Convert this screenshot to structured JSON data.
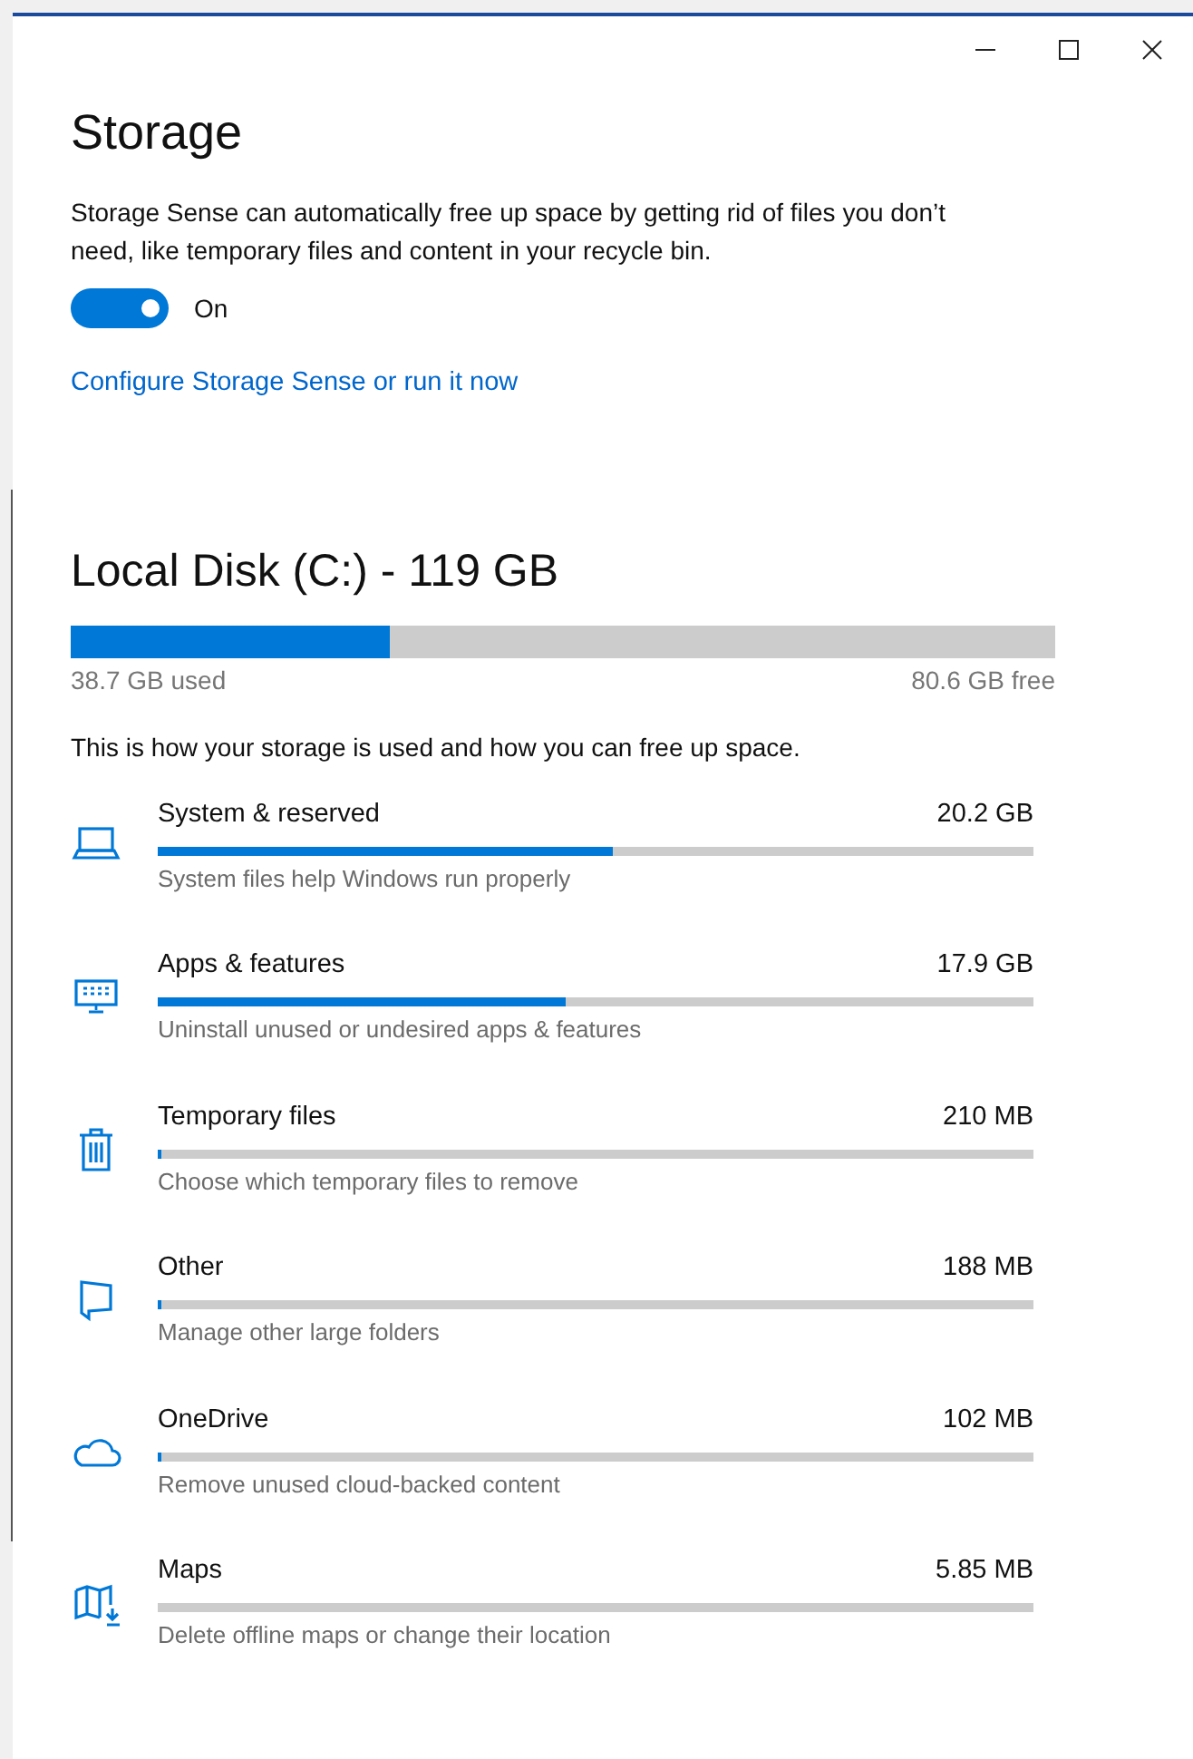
{
  "title": "Storage",
  "storage_sense": {
    "description": "Storage Sense can automatically free up space by getting rid of files you don’t need, like temporary files and content in your recycle bin.",
    "toggle": {
      "on": true,
      "label": "On"
    },
    "link": "Configure Storage Sense or run it now"
  },
  "disk": {
    "title": "Local Disk (C:) - 119 GB",
    "level": 0.325,
    "used": "38.7 GB used",
    "free": "80.6 GB free",
    "info": "This is how your storage is used and how you can free up space."
  },
  "categories": [
    {
      "kind": "system",
      "name": "System & reserved",
      "size": "20.2 GB",
      "level": 0.52,
      "description": "System files help Windows run properly"
    },
    {
      "kind": "apps",
      "name": "Apps & features",
      "size": "17.9 GB",
      "level": 0.466,
      "description": "Uninstall unused or undesired apps & features"
    },
    {
      "kind": "temp",
      "name": "Temporary files",
      "size": "210 MB",
      "level": 0.005,
      "description": "Choose which temporary files to remove"
    },
    {
      "kind": "other",
      "name": "Other",
      "size": "188 MB",
      "level": 0.005,
      "description": "Manage other large folders"
    },
    {
      "kind": "onedrive",
      "name": "OneDrive",
      "size": "102 MB",
      "level": 0.003,
      "description": "Remove unused cloud-backed content"
    },
    {
      "kind": "maps",
      "name": "Maps",
      "size": "5.85 MB",
      "level": 0,
      "description": "Delete offline maps or change their location"
    }
  ]
}
